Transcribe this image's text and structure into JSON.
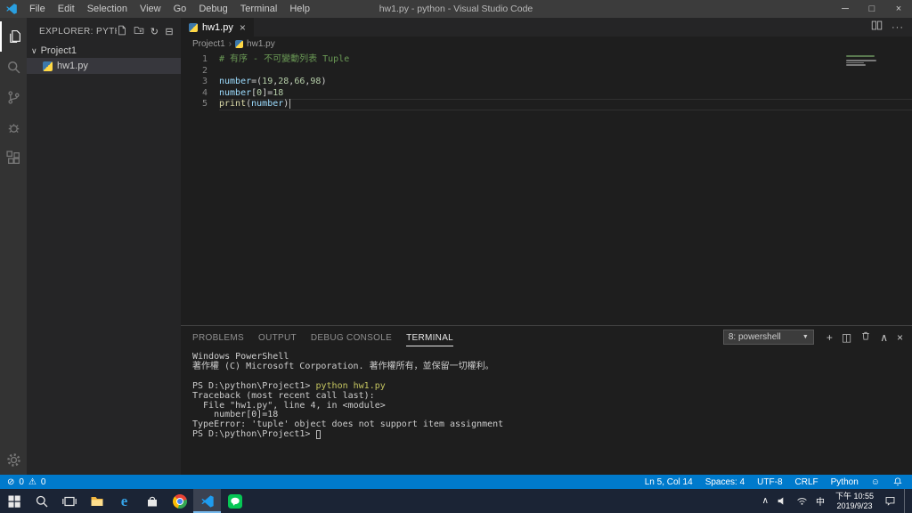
{
  "title_bar": {
    "title": "hw1.py - python - Visual Studio Code",
    "menus": [
      "File",
      "Edit",
      "Selection",
      "View",
      "Go",
      "Debug",
      "Terminal",
      "Help"
    ]
  },
  "icons": {
    "minimize": "─",
    "maximize": "□",
    "close": "×",
    "chevron_down": "∨",
    "chevron_up": "∧",
    "breadcrumb_sep": "›",
    "dropdown_arrow": "▼",
    "error": "⊘",
    "warning": "⚠",
    "smiley": "☺",
    "plus": "+",
    "split_box": "◫",
    "more": "···",
    "refresh": "↻",
    "collapse_all": "⊟",
    "edge_logo": "e"
  },
  "sidebar": {
    "header": "EXPLORER: PYTH...",
    "folder": "Project1",
    "files": [
      {
        "name": "hw1.py",
        "selected": true
      }
    ]
  },
  "editor": {
    "tab": "hw1.py",
    "breadcrumb": [
      "Project1",
      "hw1.py"
    ],
    "code_lines": [
      {
        "num": 1,
        "tokens": [
          {
            "t": "# 有序 - 不可變動列表 Tuple",
            "c": "comment"
          }
        ]
      },
      {
        "num": 2,
        "tokens": []
      },
      {
        "num": 3,
        "tokens": [
          {
            "t": "number",
            "c": "var"
          },
          {
            "t": "=(",
            "c": "plain"
          },
          {
            "t": "19",
            "c": "num"
          },
          {
            "t": ",",
            "c": "plain"
          },
          {
            "t": "28",
            "c": "num"
          },
          {
            "t": ",",
            "c": "plain"
          },
          {
            "t": "66",
            "c": "num"
          },
          {
            "t": ",",
            "c": "plain"
          },
          {
            "t": "98",
            "c": "num"
          },
          {
            "t": ")",
            "c": "plain"
          }
        ]
      },
      {
        "num": 4,
        "tokens": [
          {
            "t": "number",
            "c": "var"
          },
          {
            "t": "[",
            "c": "plain"
          },
          {
            "t": "0",
            "c": "num"
          },
          {
            "t": "]=",
            "c": "plain"
          },
          {
            "t": "18",
            "c": "num"
          }
        ]
      },
      {
        "num": 5,
        "current": true,
        "tokens": [
          {
            "t": "print",
            "c": "func"
          },
          {
            "t": "(",
            "c": "plain"
          },
          {
            "t": "number",
            "c": "var"
          },
          {
            "t": ")",
            "c": "plain"
          }
        ]
      }
    ]
  },
  "panel": {
    "tabs": [
      {
        "label": "PROBLEMS"
      },
      {
        "label": "OUTPUT"
      },
      {
        "label": "DEBUG CONSOLE"
      },
      {
        "label": "TERMINAL",
        "active": true
      }
    ],
    "shell_select": "8: powershell",
    "terminal_lines": [
      [
        {
          "t": "Windows PowerShell"
        }
      ],
      [
        {
          "t": "著作權 (C) Microsoft Corporation. 著作權所有，並保留一切權利。"
        }
      ],
      [],
      [
        {
          "t": "PS D:\\python\\Project1> "
        },
        {
          "t": "python hw1.py",
          "c": "cmd"
        }
      ],
      [
        {
          "t": "Traceback (most recent call last):"
        }
      ],
      [
        {
          "t": "  File \"hw1.py\", line 4, in <module>"
        }
      ],
      [
        {
          "t": "    number[0]=18"
        }
      ],
      [
        {
          "t": "TypeError: 'tuple' object does not support item assignment"
        }
      ],
      [
        {
          "t": "PS D:\\python\\Project1> "
        },
        {
          "c": "cursor"
        }
      ]
    ]
  },
  "status_bar": {
    "errors": "0",
    "warnings": "0",
    "items_right": [
      "Ln 5, Col 14",
      "Spaces: 4",
      "UTF-8",
      "CRLF",
      "Python"
    ]
  },
  "taskbar": {
    "ime": "中",
    "time": "下午 10:55",
    "date": "2019/9/23"
  },
  "colors": {
    "accent": "#007acc",
    "statusbar": "#007acc",
    "titlebar": "#3c3c3c",
    "editor_bg": "#1e1e1e"
  }
}
